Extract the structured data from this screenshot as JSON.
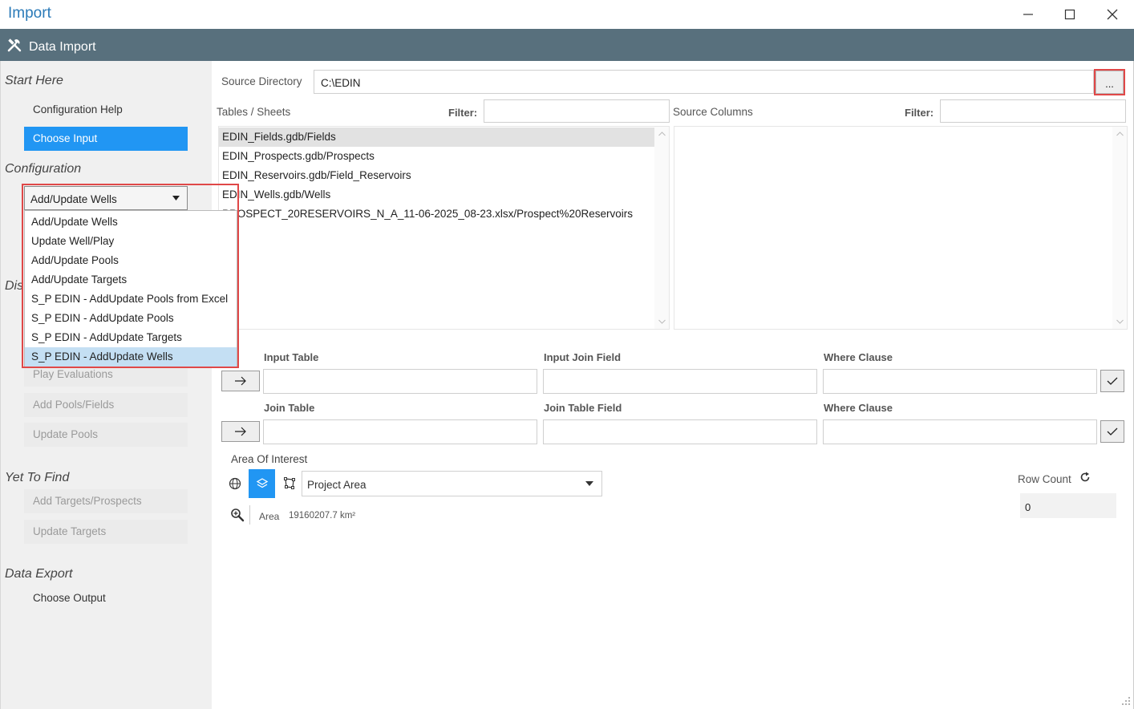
{
  "window": {
    "title": "Import"
  },
  "header": {
    "title": "Data Import"
  },
  "sidebar": {
    "start_here": "Start Here",
    "config_help": "Configuration Help",
    "choose_input": "Choose Input",
    "configuration": "Configuration",
    "combo_value": "Add/Update Wells",
    "partial_section": "Dis",
    "play_evaluations": "Play Evaluations",
    "add_pools_fields": "Add Pools/Fields",
    "update_pools": "Update Pools",
    "yet_to_find": "Yet To Find",
    "add_targets": "Add Targets/Prospects",
    "update_targets": "Update Targets",
    "data_export": "Data Export",
    "choose_output": "Choose Output"
  },
  "dropdown": {
    "options": [
      "Add/Update Wells",
      "Update Well/Play",
      "Add/Update Pools",
      "Add/Update Targets",
      "S_P EDIN - AddUpdate Pools from Excel",
      "S_P EDIN - AddUpdate Pools",
      "S_P EDIN - AddUpdate Targets",
      "S_P EDIN - AddUpdate Wells"
    ],
    "selected_index": 7
  },
  "source": {
    "label": "Source Directory",
    "value": "C:\\EDIN",
    "browse": "..."
  },
  "tables": {
    "label": "Tables / Sheets",
    "filter_label": "Filter:",
    "items": [
      "EDIN_Fields.gdb/Fields",
      "EDIN_Prospects.gdb/Prospects",
      "EDIN_Reservoirs.gdb/Field_Reservoirs",
      "EDIN_Wells.gdb/Wells",
      "PROSPECT_20RESERVOIRS_N_A_11-06-2025_08-23.xlsx/Prospect%20Reservoirs"
    ]
  },
  "columns": {
    "label": "Source Columns",
    "filter_label": "Filter:"
  },
  "join": {
    "input_table": "Input Table",
    "input_join_field": "Input Join Field",
    "where1": "Where Clause",
    "join_table": "Join Table",
    "join_table_field": "Join Table Field",
    "where2": "Where Clause"
  },
  "aoi": {
    "label": "Area Of Interest",
    "select_value": "Project Area",
    "area_label": "Area",
    "area_value": "19160207.7 km²"
  },
  "rowcount": {
    "label": "Row Count",
    "value": "0"
  }
}
